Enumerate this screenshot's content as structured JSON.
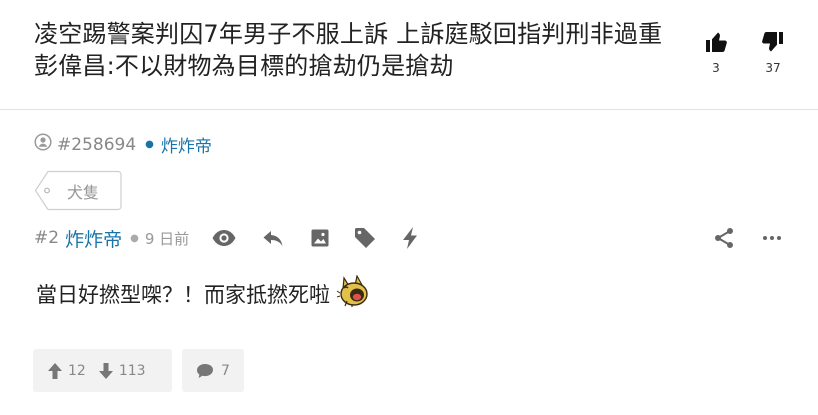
{
  "thread": {
    "title": "凌空踢警案判囚7年男子不服上訴 上訴庭駁回指判刑非過重 彭偉昌:不以財物為目標的搶劫仍是搶劫",
    "upvotes": "3",
    "downvotes": "37"
  },
  "op_meta": {
    "user_id": "#258694",
    "author": "炸炸帝"
  },
  "tag": {
    "label": "犬隻"
  },
  "post": {
    "number": "#2",
    "author": "炸炸帝",
    "time": "9 日前",
    "content": "當日好撚型㗎？！而家抵撚死啦",
    "upvotes": "12",
    "downvotes": "113",
    "comments": "7"
  },
  "icons": {
    "thread_up": "thumbs-up-icon",
    "thread_down": "thumbs-down-icon",
    "user": "user-icon",
    "view": "eye-icon",
    "reply": "reply-icon",
    "image": "image-icon",
    "tag": "tag-icon",
    "flash": "lightning-icon",
    "share": "share-icon",
    "more": "more-icon",
    "arrow_up": "arrow-up-icon",
    "arrow_down": "arrow-down-icon",
    "comment": "comment-icon",
    "emoji": "laughing-emoji-icon"
  },
  "colors": {
    "link": "#1a73a8",
    "muted": "#888888",
    "button_bg": "#f2f2f2",
    "icon": "#666666"
  }
}
